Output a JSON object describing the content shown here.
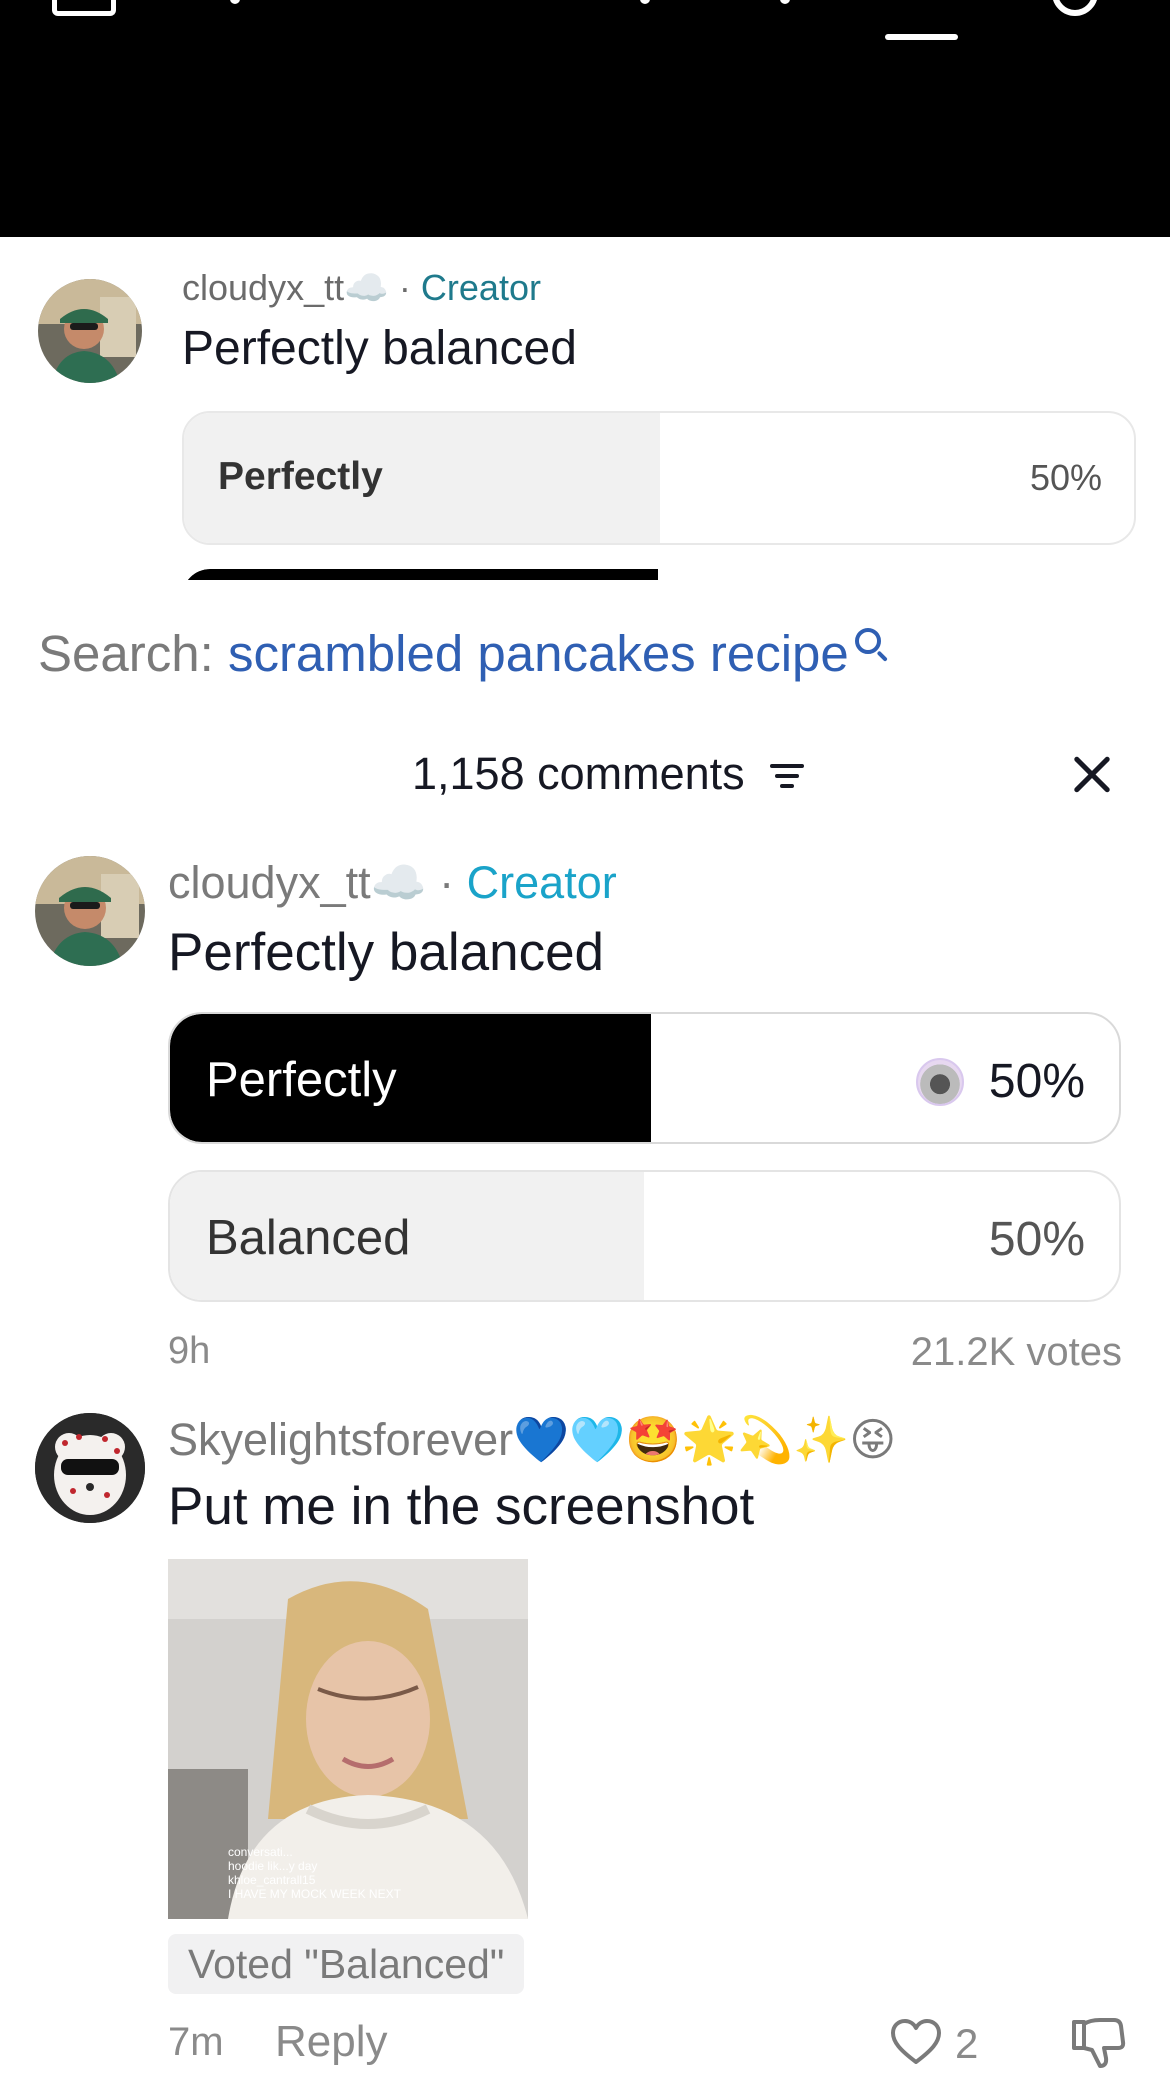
{
  "background_comment": {
    "username": "cloudyx_tt",
    "cloud_emoji": "☁️",
    "separator": " · ",
    "creator_label": "Creator",
    "text": "Perfectly balanced",
    "option_label": "Perfectly",
    "option_percent": "50%"
  },
  "search": {
    "label": "Search: ",
    "query": "scrambled pancakes recipe",
    "icon": "search-icon"
  },
  "comments_header": {
    "count_label": "1,158 comments",
    "sort_icon": "sort-icon",
    "close_icon": "close-icon"
  },
  "poll_comment": {
    "username": "cloudyx_tt",
    "cloud_emoji": "☁️",
    "separator": " · ",
    "creator_label": "Creator",
    "text": "Perfectly balanced",
    "options": [
      {
        "label": "Perfectly",
        "percent": "50%",
        "share": 0.5,
        "selected": true
      },
      {
        "label": "Balanced",
        "percent": "50%",
        "share": 0.5,
        "selected": false
      }
    ],
    "time": "9h",
    "votes": "21.2K votes"
  },
  "reply_comment": {
    "username": "Skyelightsforever",
    "username_emojis": "💙🩵🤩🌟💫✨😝",
    "text": "Put me in the screenshot",
    "image_overlay_lines": [
      "conversati...",
      "hoodie lik...y day",
      "khloe_cantrall15",
      "I HAVE MY MOCK WEEK NEXT"
    ],
    "voted_badge": "Voted \"Balanced\"",
    "time": "7m",
    "reply_label": "Reply",
    "like_count": "2",
    "like_icon": "heart-icon",
    "dislike_icon": "thumbs-down-icon"
  },
  "colors": {
    "creator_primary": "#1aa3c9",
    "search_query": "#2f5fb3",
    "selected_fill": "#000000",
    "unselected_fill": "#f1f1f1",
    "muted_text": "#8a8a8a"
  }
}
